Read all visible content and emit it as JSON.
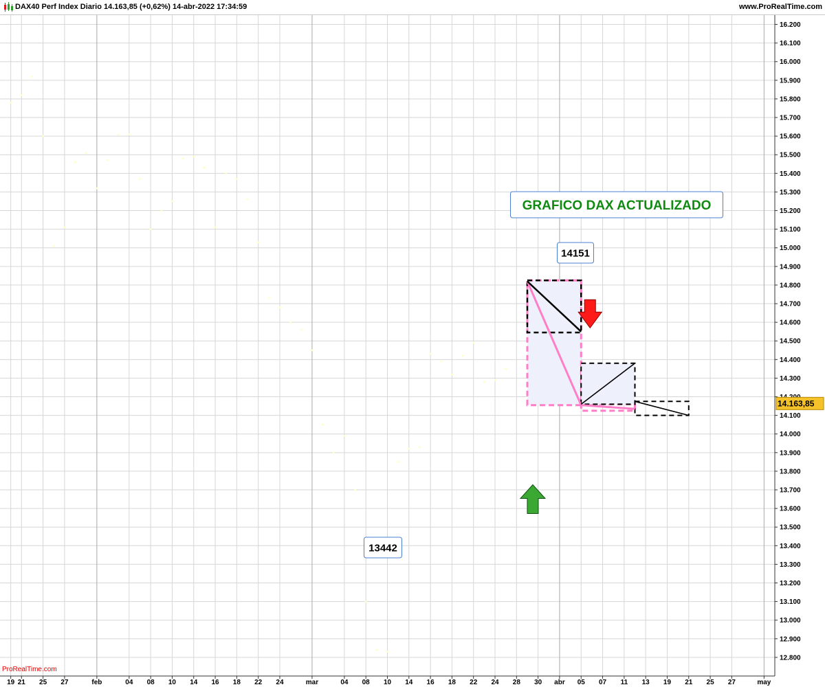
{
  "header": {
    "title": "DAX40 Perf Index Diario 14.163,85 (+0,62%) 14-abr-2022 17:34:59",
    "site": "www.ProRealTime.com",
    "app_icon": "candlestick-icon"
  },
  "watermark": "ProRealTime.com",
  "colors": {
    "grid": "#d6d6d6",
    "price_dots": "#ffffc0",
    "pink": "#ff7ec8",
    "box_fill": "#eef0fb",
    "green_arrow": "#3aa832",
    "red_arrow": "#ff1a1a",
    "last_price_bg": "#f5c22a",
    "title_green": "#118a11",
    "label_border": "#4a7fd0"
  },
  "chart_data": {
    "type": "line",
    "title": "DAX40 Perf Index Diario",
    "ylim": [
      12700,
      16250
    ],
    "y_ticks": [
      12800,
      12900,
      13000,
      13100,
      13200,
      13300,
      13400,
      13500,
      13600,
      13700,
      13800,
      13900,
      14000,
      14100,
      14200,
      14300,
      14400,
      14500,
      14600,
      14700,
      14800,
      14900,
      15000,
      15100,
      15200,
      15300,
      15400,
      15500,
      15600,
      15700,
      15800,
      15900,
      16000,
      16100,
      16200
    ],
    "y_tick_labels": [
      "12.800",
      "12.900",
      "13.000",
      "13.100",
      "13.200",
      "13.300",
      "13.400",
      "13.500",
      "13.600",
      "13.700",
      "13.800",
      "13.900",
      "14.000",
      "14.100",
      "14.200",
      "14.300",
      "14.400",
      "14.500",
      "14.600",
      "14.700",
      "14.800",
      "14.900",
      "15.000",
      "15.100",
      "15.200",
      "15.300",
      "15.400",
      "15.500",
      "15.600",
      "15.700",
      "15.800",
      "15.900",
      "16.000",
      "16.100",
      "16.200"
    ],
    "x_tick_labels": [
      "19",
      "21",
      "25",
      "27",
      "feb",
      "04",
      "08",
      "10",
      "14",
      "16",
      "18",
      "22",
      "24",
      "mar",
      "04",
      "08",
      "10",
      "14",
      "16",
      "18",
      "22",
      "24",
      "28",
      "30",
      "abr",
      "05",
      "07",
      "11",
      "13",
      "19",
      "21",
      "25",
      "27",
      "may"
    ],
    "x_tick_slots": [
      0,
      1,
      3,
      5,
      8,
      11,
      13,
      15,
      17,
      19,
      21,
      23,
      25,
      28,
      31,
      33,
      35,
      37,
      39,
      41,
      43,
      45,
      47,
      49,
      51,
      53,
      55,
      57,
      59,
      61,
      63,
      65,
      67,
      70
    ],
    "major_x_slots": [
      8,
      28,
      51,
      70
    ],
    "x_slot_range": [
      -1,
      71
    ],
    "last_price": 14163.85,
    "last_price_label": "14.163,85",
    "series": [
      {
        "values": [
          [
            0,
            15780
          ],
          [
            1,
            15820
          ],
          [
            2,
            15920
          ],
          [
            3,
            15600
          ],
          [
            4,
            15010
          ],
          [
            5,
            15110
          ],
          [
            6,
            15460
          ],
          [
            7,
            15510
          ],
          [
            8,
            15320
          ],
          [
            9,
            15470
          ],
          [
            10,
            15610
          ],
          [
            11,
            15610
          ],
          [
            12,
            15370
          ],
          [
            13,
            15100
          ],
          [
            14,
            15200
          ],
          [
            15,
            15250
          ],
          [
            16,
            15480
          ],
          [
            17,
            15490
          ],
          [
            18,
            15430
          ],
          [
            19,
            15110
          ],
          [
            20,
            15400
          ],
          [
            21,
            15370
          ],
          [
            22,
            15260
          ],
          [
            23,
            15030
          ],
          [
            24,
            14730
          ],
          [
            25,
            14680
          ],
          [
            26,
            14600
          ],
          [
            27,
            14560
          ],
          [
            28,
            14450
          ],
          [
            29,
            14050
          ],
          [
            30,
            13900
          ],
          [
            31,
            13990
          ],
          [
            32,
            13700
          ],
          [
            33,
            13100
          ],
          [
            34,
            12840
          ],
          [
            35,
            12830
          ],
          [
            36,
            13850
          ],
          [
            37,
            13920
          ],
          [
            38,
            13930
          ],
          [
            39,
            14430
          ],
          [
            40,
            14390
          ],
          [
            41,
            14320
          ],
          [
            42,
            14420
          ],
          [
            43,
            14490
          ],
          [
            44,
            14280
          ],
          [
            45,
            14290
          ],
          [
            46,
            14350
          ]
        ]
      }
    ],
    "annotations": {
      "headline": "GRAFICO DAX ACTUALIZADO",
      "top_label": "14151",
      "bottom_label": "13442",
      "up_arrow_at": [
        48,
        13580
      ],
      "down_arrow_at": [
        53,
        14640
      ]
    }
  }
}
